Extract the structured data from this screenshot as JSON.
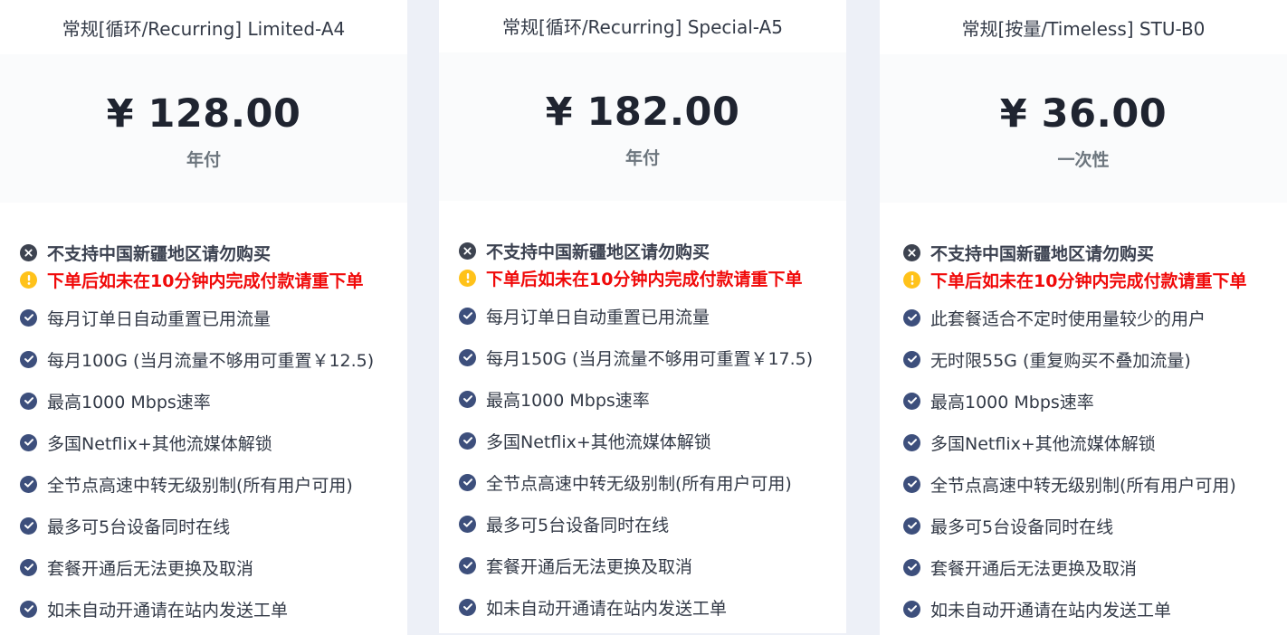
{
  "plans": [
    {
      "title": "常规[循环/Recurring] Limited-A4",
      "price": "¥ 128.00",
      "period": "年付",
      "notice": "不支持中国新疆地区请勿购买",
      "alert": "下单后如未在10分钟内完成付款请重下单",
      "features": [
        "每月订单日自动重置已用流量",
        "每月100G (当月流量不够用可重置￥12.5)",
        "最高1000 Mbps速率",
        "多国Netflix+其他流媒体解锁",
        "全节点高速中转无级别制(所有用户可用)",
        "最多可5台设备同时在线",
        "套餐开通后无法更换及取消",
        "如未自动开通请在站内发送工单"
      ]
    },
    {
      "title": "常规[循环/Recurring] Special-A5",
      "price": "¥ 182.00",
      "period": "年付",
      "notice": "不支持中国新疆地区请勿购买",
      "alert": "下单后如未在10分钟内完成付款请重下单",
      "features": [
        "每月订单日自动重置已用流量",
        "每月150G (当月流量不够用可重置￥17.5)",
        "最高1000 Mbps速率",
        "多国Netflix+其他流媒体解锁",
        "全节点高速中转无级别制(所有用户可用)",
        "最多可5台设备同时在线",
        "套餐开通后无法更换及取消",
        "如未自动开通请在站内发送工单"
      ]
    },
    {
      "title": "常规[按量/Timeless] STU-B0",
      "price": "¥ 36.00",
      "period": "一次性",
      "notice": "不支持中国新疆地区请勿购买",
      "alert": "下单后如未在10分钟内完成付款请重下单",
      "features": [
        "此套餐适合不定时使用量较少的用户",
        "无时限55G (重复购买不叠加流量)",
        "最高1000 Mbps速率",
        "多国Netflix+其他流媒体解锁",
        "全节点高速中转无级别制(所有用户可用)",
        "最多可5台设备同时在线",
        "套餐开通后无法更换及取消",
        "如未自动开通请在站内发送工单"
      ]
    }
  ],
  "icons": {
    "notice": "times-circle-icon",
    "alert": "exclamation-circle-icon",
    "feature": "check-circle-icon"
  },
  "colors": {
    "alert_text": "#f00a0a",
    "alert_icon": "#ffc21a",
    "check_icon": "#3d4f7c",
    "page_bg": "#edf0f7"
  }
}
